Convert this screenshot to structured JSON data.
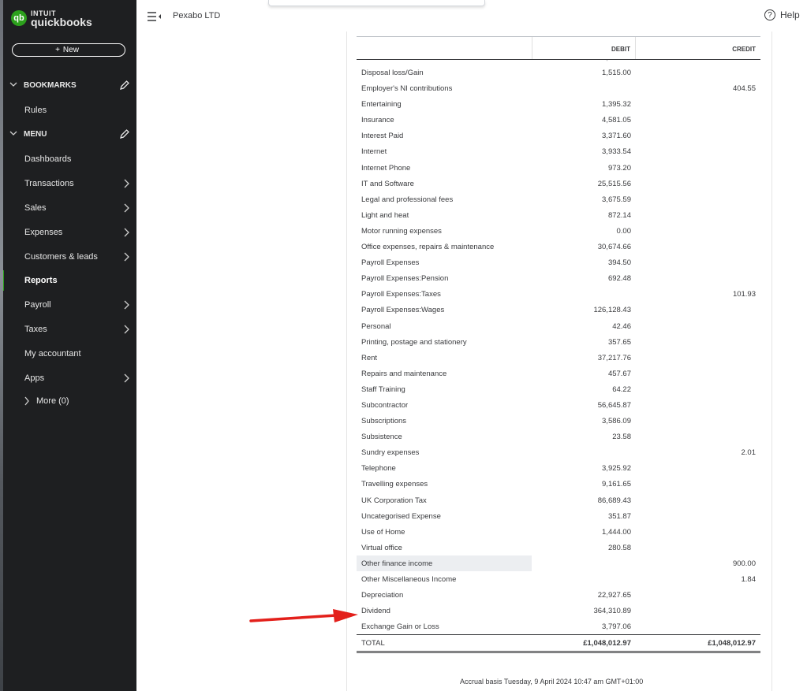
{
  "app": {
    "logo_top": "INTUIT",
    "logo_bottom": "quickbooks",
    "logo_badge": "qb",
    "company": "Pexabo LTD",
    "help": "Help",
    "help_icon": "?"
  },
  "sidebar": {
    "new_label": "New",
    "new_icon": "+",
    "bookmarks_label": "BOOKMARKS",
    "bookmarks": [
      {
        "label": "Rules"
      }
    ],
    "menu_label": "MENU",
    "menu": [
      {
        "label": "Dashboards",
        "arrow": false,
        "active": false
      },
      {
        "label": "Transactions",
        "arrow": true,
        "active": false
      },
      {
        "label": "Sales",
        "arrow": true,
        "active": false
      },
      {
        "label": "Expenses",
        "arrow": true,
        "active": false
      },
      {
        "label": "Customers & leads",
        "arrow": true,
        "active": false
      },
      {
        "label": "Reports",
        "arrow": false,
        "active": true
      },
      {
        "label": "Payroll",
        "arrow": true,
        "active": false
      },
      {
        "label": "Taxes",
        "arrow": true,
        "active": false
      },
      {
        "label": "My accountant",
        "arrow": false,
        "active": false
      },
      {
        "label": "Apps",
        "arrow": true,
        "active": false
      }
    ],
    "more_label": "More (0)"
  },
  "report": {
    "header_debit": "DEBIT",
    "header_credit": "CREDIT",
    "rows": [
      {
        "account": "Disposal loss/Gain",
        "debit": "1,515.00",
        "credit": ""
      },
      {
        "account": "Employer's NI contributions",
        "debit": "",
        "credit": "404.55"
      },
      {
        "account": "Entertaining",
        "debit": "1,395.32",
        "credit": ""
      },
      {
        "account": "Insurance",
        "debit": "4,581.05",
        "credit": ""
      },
      {
        "account": "Interest Paid",
        "debit": "3,371.60",
        "credit": ""
      },
      {
        "account": "Internet",
        "debit": "3,933.54",
        "credit": ""
      },
      {
        "account": "Internet Phone",
        "debit": "973.20",
        "credit": ""
      },
      {
        "account": "IT and Software",
        "debit": "25,515.56",
        "credit": ""
      },
      {
        "account": "Legal and professional fees",
        "debit": "3,675.59",
        "credit": ""
      },
      {
        "account": "Light and heat",
        "debit": "872.14",
        "credit": ""
      },
      {
        "account": "Motor running expenses",
        "debit": "0.00",
        "credit": ""
      },
      {
        "account": "Office expenses, repairs & maintenance",
        "debit": "30,674.66",
        "credit": ""
      },
      {
        "account": "Payroll Expenses",
        "debit": "394.50",
        "credit": ""
      },
      {
        "account": "Payroll Expenses:Pension",
        "debit": "692.48",
        "credit": ""
      },
      {
        "account": "Payroll Expenses:Taxes",
        "debit": "",
        "credit": "101.93"
      },
      {
        "account": "Payroll Expenses:Wages",
        "debit": "126,128.43",
        "credit": ""
      },
      {
        "account": "Personal",
        "debit": "42.46",
        "credit": ""
      },
      {
        "account": "Printing, postage and stationery",
        "debit": "357.65",
        "credit": ""
      },
      {
        "account": "Rent",
        "debit": "37,217.76",
        "credit": ""
      },
      {
        "account": "Repairs and maintenance",
        "debit": "457.67",
        "credit": ""
      },
      {
        "account": "Staff Training",
        "debit": "64.22",
        "credit": ""
      },
      {
        "account": "Subcontractor",
        "debit": "56,645.87",
        "credit": ""
      },
      {
        "account": "Subscriptions",
        "debit": "3,586.09",
        "credit": ""
      },
      {
        "account": "Subsistence",
        "debit": "23.58",
        "credit": ""
      },
      {
        "account": "Sundry expenses",
        "debit": "",
        "credit": "2.01"
      },
      {
        "account": "Telephone",
        "debit": "3,925.92",
        "credit": ""
      },
      {
        "account": "Travelling expenses",
        "debit": "9,161.65",
        "credit": ""
      },
      {
        "account": "UK Corporation Tax",
        "debit": "86,689.43",
        "credit": ""
      },
      {
        "account": "Uncategorised Expense",
        "debit": "351.87",
        "credit": ""
      },
      {
        "account": "Use of Home",
        "debit": "1,444.00",
        "credit": ""
      },
      {
        "account": "Virtual office",
        "debit": "280.58",
        "credit": ""
      },
      {
        "account": "Other finance income",
        "debit": "",
        "credit": "900.00",
        "highlight": true
      },
      {
        "account": "Other Miscellaneous Income",
        "debit": "",
        "credit": "1.84"
      },
      {
        "account": "Depreciation",
        "debit": "22,927.65",
        "credit": ""
      },
      {
        "account": "Dividend",
        "debit": "364,310.89",
        "credit": ""
      },
      {
        "account": "Exchange Gain or Loss",
        "debit": "3,797.06",
        "credit": ""
      }
    ],
    "total": {
      "label": "TOTAL",
      "debit": "£1,048,012.97",
      "credit": "£1,048,012.97"
    },
    "footer": "Accrual basis  Tuesday, 9 April 2024  10:47 am GMT+01:00"
  },
  "colors": {
    "sidebar_bg": "#1e1f21",
    "brand_green": "#2ca01c",
    "annotation_arrow": "#e3201b"
  }
}
